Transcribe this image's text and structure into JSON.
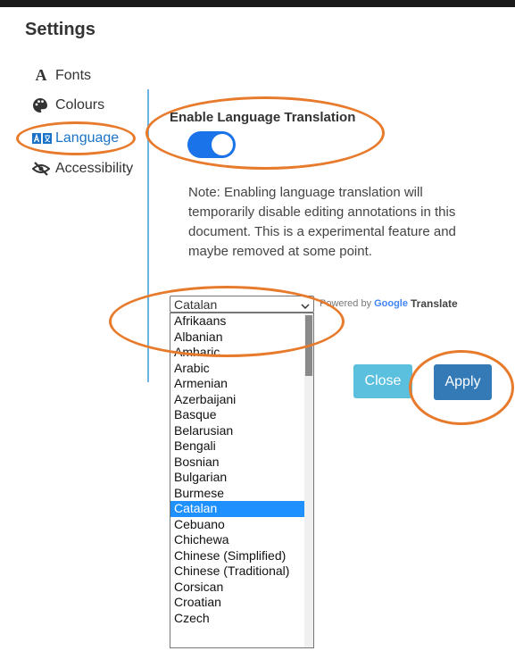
{
  "title": "Settings",
  "nav": [
    {
      "label": "Fonts",
      "icon": "font-icon"
    },
    {
      "label": "Colours",
      "icon": "palette-icon"
    },
    {
      "label": "Language",
      "icon": "translate-icon"
    },
    {
      "label": "Accessibility",
      "icon": "eye-slash-icon"
    }
  ],
  "section": {
    "title": "Enable Language Translation",
    "toggle_on": true,
    "note": "Note: Enabling language translation will temporarily disable editing annotations in this document. This is a experimental feature and maybe removed at some point."
  },
  "language_select": {
    "selected": "Catalan",
    "options": [
      "Afrikaans",
      "Albanian",
      "Amharic",
      "Arabic",
      "Armenian",
      "Azerbaijani",
      "Basque",
      "Belarusian",
      "Bengali",
      "Bosnian",
      "Bulgarian",
      "Burmese",
      "Catalan",
      "Cebuano",
      "Chichewa",
      "Chinese (Simplified)",
      "Chinese (Traditional)",
      "Corsican",
      "Croatian",
      "Czech"
    ]
  },
  "powered": {
    "prefix": "Powered by",
    "google": "Google",
    "translate": "Translate"
  },
  "buttons": {
    "close": "Close",
    "apply": "Apply"
  },
  "colors": {
    "accent": "#1a73c8",
    "toggle": "#1a73e8",
    "close_btn": "#5bc0de",
    "apply_btn": "#337ab7",
    "highlight_ring": "#e87a2c",
    "selected_option": "#1e90ff"
  }
}
